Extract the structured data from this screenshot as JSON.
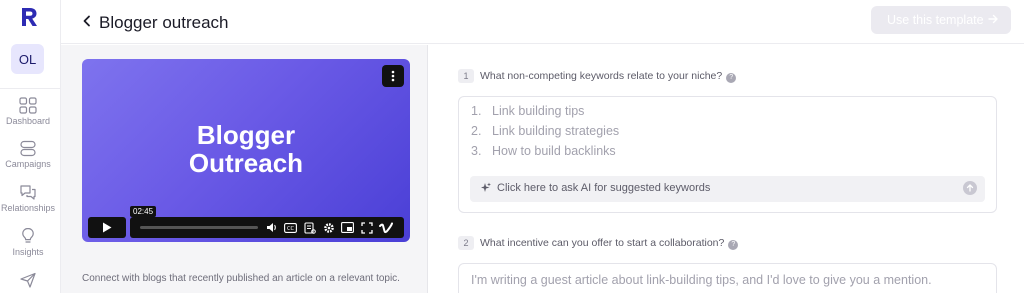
{
  "sidebar": {
    "avatar_initials": "OL",
    "items": [
      {
        "label": "Dashboard",
        "icon": "grid-icon"
      },
      {
        "label": "Campaigns",
        "icon": "campaigns-icon"
      },
      {
        "label": "Relationships",
        "icon": "chat-icon"
      },
      {
        "label": "Insights",
        "icon": "lightbulb-icon"
      },
      {
        "label": "",
        "icon": "send-icon"
      }
    ]
  },
  "header": {
    "title": "Blogger outreach",
    "use_template_label": "Use this template"
  },
  "video": {
    "title_line1": "Blogger",
    "title_line2": "Outreach",
    "timestamp": "02:45",
    "progress": 0
  },
  "left_panel": {
    "description": "Connect with blogs that recently published an article on a relevant topic."
  },
  "questions": [
    {
      "number": "1",
      "label": "What non-competing keywords relate to your niche?",
      "items": [
        {
          "num": "1.",
          "text": "Link building tips"
        },
        {
          "num": "2.",
          "text": "Link building strategies"
        },
        {
          "num": "3.",
          "text": "How to build backlinks"
        }
      ],
      "ai_prompt": "Click here to ask AI for suggested keywords"
    },
    {
      "number": "2",
      "label": "What incentive can you offer to start a collaboration?",
      "placeholder": "I'm writing a guest article about link-building tips, and I'd love to give you a mention."
    }
  ],
  "colors": {
    "brand": "#2d2bb3",
    "avatar_bg": "#e7e6fd",
    "video_gradient_start": "#7e73ee",
    "video_gradient_end": "#4a3fd6",
    "disabled_button": "#ebeaf0"
  }
}
